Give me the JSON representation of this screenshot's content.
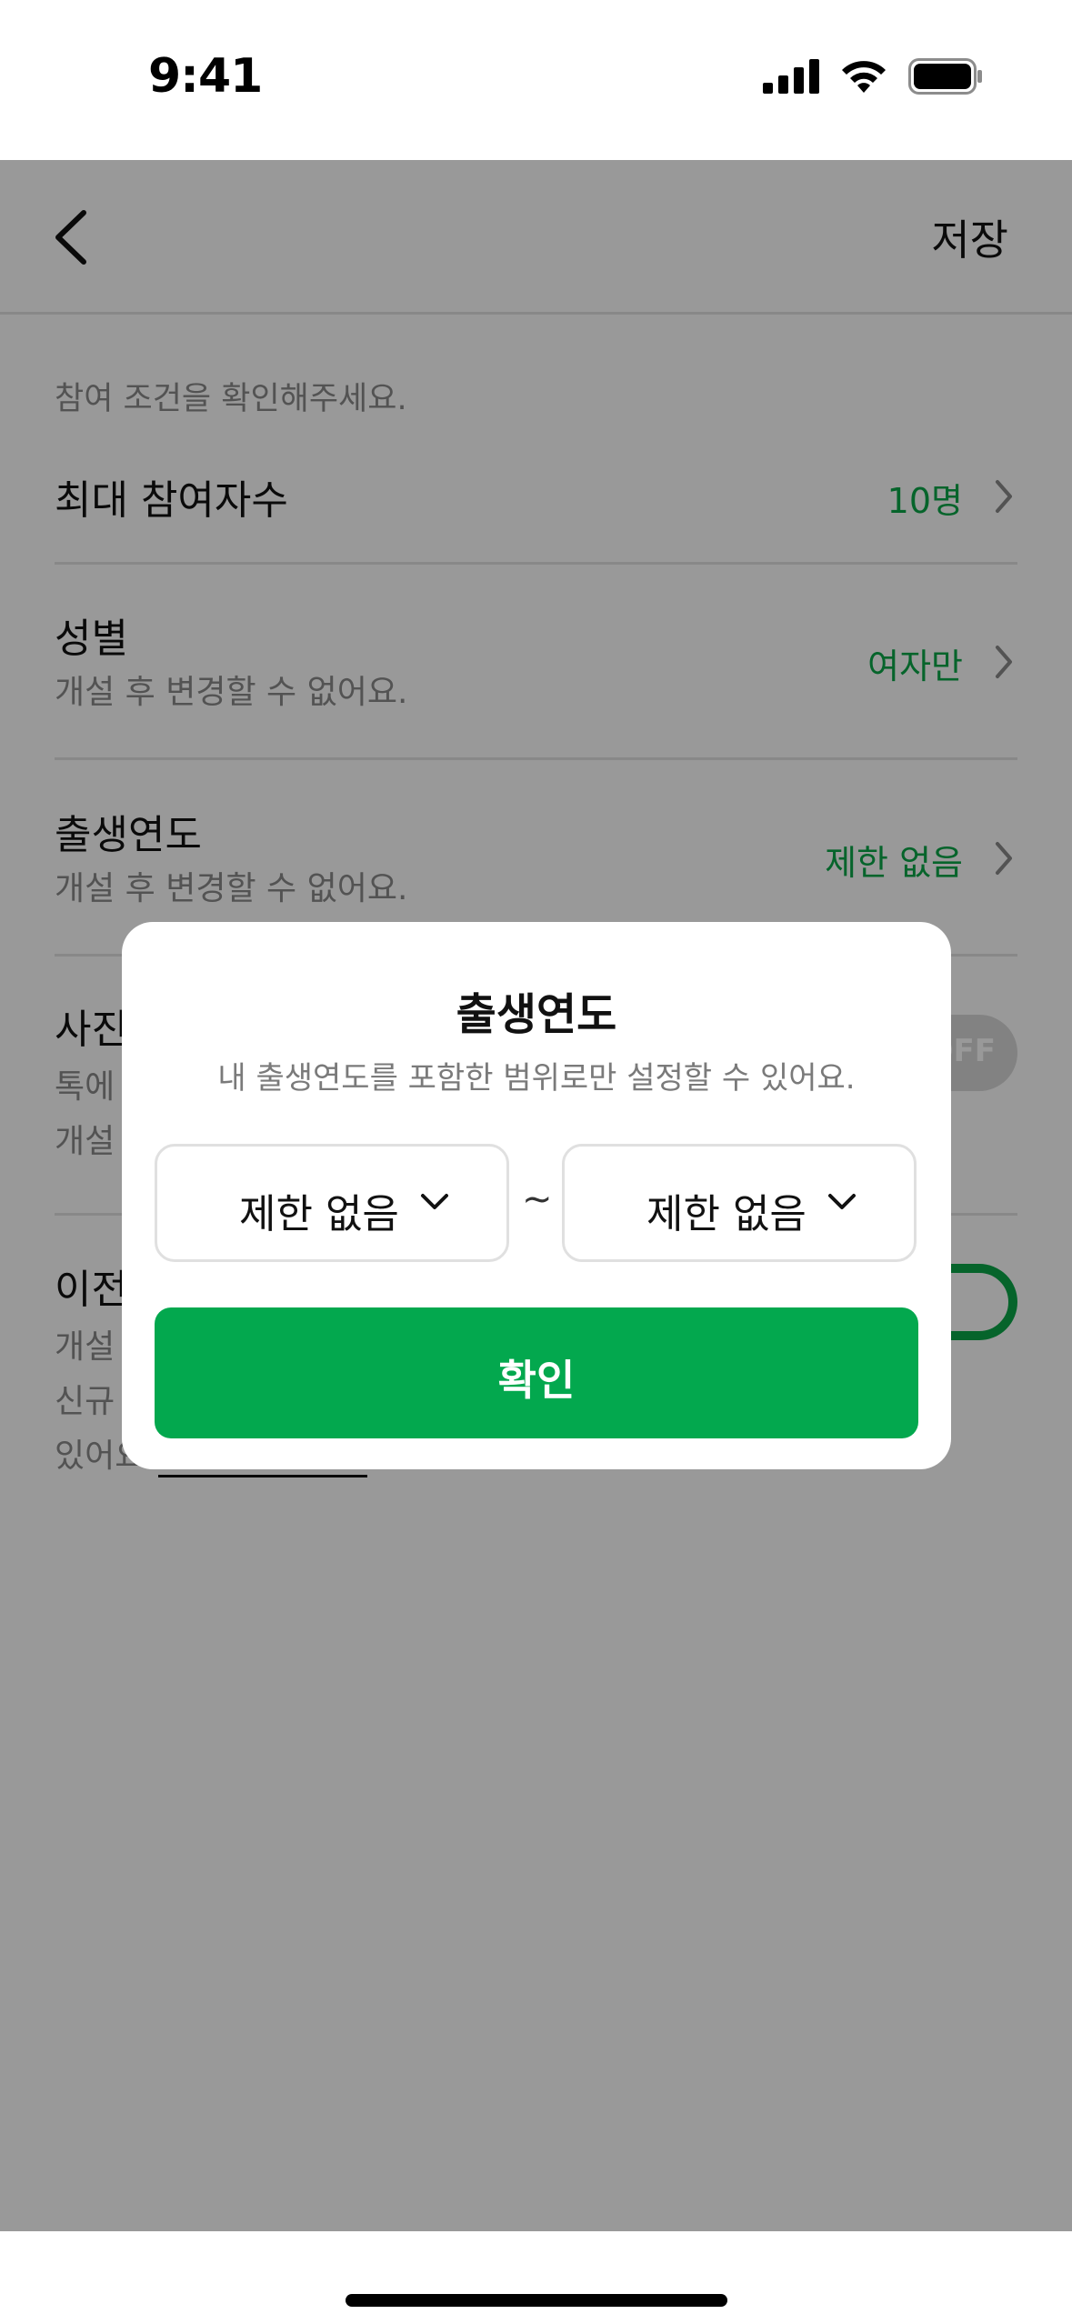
{
  "status_bar": {
    "time": "9:41"
  },
  "nav": {
    "save_label": "저장"
  },
  "notice": "참여 조건을 확인해주세요.",
  "rows": [
    {
      "title": "최대 참여자수",
      "value": "10명"
    },
    {
      "title": "성별",
      "subtitle": "개설 후 변경할 수 없어요.",
      "value": "여자만"
    },
    {
      "title": "출생연도",
      "subtitle": "개설 후 변경할 수 없어요.",
      "value": "제한 없음"
    },
    {
      "title": "사진",
      "line1": "톡에",
      "line2": "개설",
      "toggle": "OFF"
    },
    {
      "title": "이전",
      "line1": "개설",
      "line2": "신규",
      "line3": "있어요"
    }
  ],
  "modal": {
    "title": "출생연도",
    "description": "내 출생연도를 포함한 범위로만 설정할 수 있어요.",
    "from_value": "제한 없음",
    "separator": "~",
    "to_value": "제한 없음",
    "confirm_label": "확인"
  },
  "colors": {
    "accent": "#03a84e",
    "overlay": "rgba(0,0,0,0.4)"
  }
}
